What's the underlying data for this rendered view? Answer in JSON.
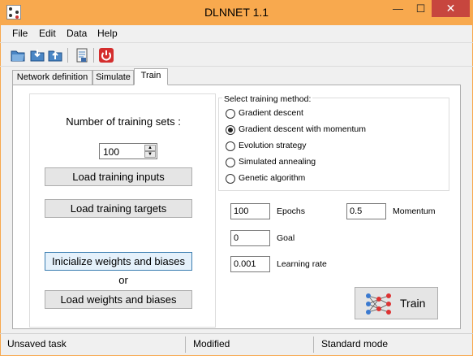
{
  "window": {
    "title": "DLNNET 1.1",
    "min_symbol": "—",
    "max_symbol": "☐",
    "close_symbol": "✕"
  },
  "menu": [
    "File",
    "Edit",
    "Data",
    "Help"
  ],
  "toolbar": {
    "icons": [
      "open-folder-icon",
      "load-icon",
      "save-icon",
      "report-icon",
      "power-icon"
    ]
  },
  "tabs": [
    "Network definition",
    "Simulate",
    "Train"
  ],
  "left": {
    "num_sets_label": "Number of training sets :",
    "num_sets_value": "100",
    "load_inputs": "Load training inputs",
    "load_targets": "Load training targets",
    "init_weights": "Inicialize weights and biases",
    "or_label": "or",
    "load_weights": "Load weights and biases"
  },
  "method": {
    "title": "Select training method:",
    "options": [
      {
        "label": "Gradient descent",
        "selected": false
      },
      {
        "label": "Gradient descent with momentum",
        "selected": true
      },
      {
        "label": "Evolution strategy",
        "selected": false
      },
      {
        "label": "Simulated annealing",
        "selected": false
      },
      {
        "label": "Genetic algorithm",
        "selected": false
      }
    ]
  },
  "params": {
    "epochs_value": "100",
    "epochs_label": "Epochs",
    "momentum_value": "0.5",
    "momentum_label": "Momentum",
    "goal_value": "0",
    "goal_label": "Goal",
    "lr_value": "0.001",
    "lr_label": "Learning rate"
  },
  "train_button": "Train",
  "status": [
    "Unsaved task",
    "Modified",
    "Standard mode"
  ],
  "colors": {
    "title_bar": "#f8a94e",
    "close_button": "#c7463e"
  }
}
